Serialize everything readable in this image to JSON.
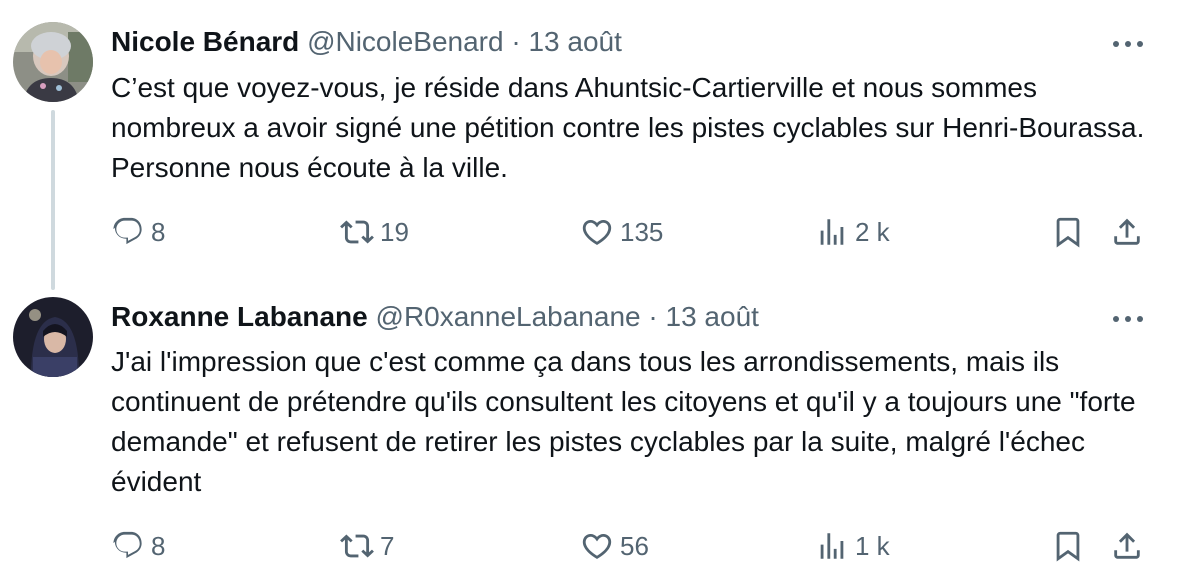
{
  "tweets": [
    {
      "author": "Nicole Bénard",
      "handle": "@NicoleBenard",
      "separator": "·",
      "date": "13 août",
      "text": "C’est que voyez-vous, je réside dans Ahuntsic-Cartierville et nous sommes nombreux a avoir signé une pétition contre les pistes cyclables sur Henri-Bourassa. Personne nous écoute à la ville.",
      "replies": "8",
      "retweets": "19",
      "likes": "135",
      "views": "2 k",
      "avatar_icon": "avatar-photo-icon"
    },
    {
      "author": "Roxanne Labanane",
      "handle": "@R0xanneLabanane",
      "separator": "·",
      "date": "13 août",
      "text": "J'ai l'impression que c'est comme ça dans tous les arrondissements, mais ils continuent de prétendre qu'ils consultent les citoyens et qu'il y a toujours une \"forte demande\" et refusent de retirer les pistes cyclables par la suite, malgré l'échec évident",
      "replies": "8",
      "retweets": "7",
      "likes": "56",
      "views": "1 k",
      "avatar_icon": "avatar-photo-icon"
    }
  ],
  "colors": {
    "text": "#0f1419",
    "secondary": "#536471",
    "thread_line": "#cfd9de"
  },
  "icons": [
    "reply-icon",
    "retweet-icon",
    "like-icon",
    "views-icon",
    "bookmark-icon",
    "share-icon",
    "more-icon"
  ]
}
